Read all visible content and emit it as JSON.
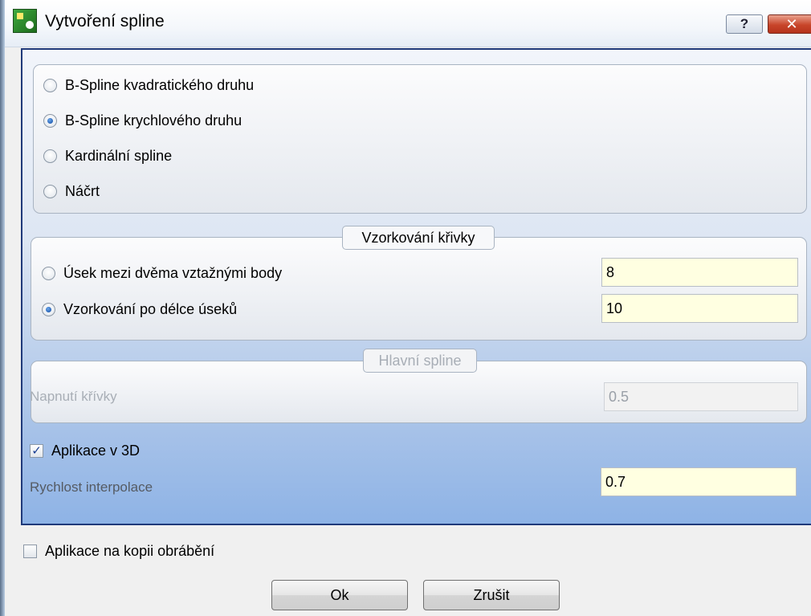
{
  "window": {
    "title": "Vytvoření spline",
    "help_label": "?",
    "close_label": "✕"
  },
  "spline_type": {
    "options": [
      {
        "label": "B-Spline kvadratického druhu",
        "checked": false
      },
      {
        "label": "B-Spline krychlového druhu",
        "checked": true
      },
      {
        "label": "Kardinální spline",
        "checked": false
      },
      {
        "label": "Náčrt",
        "checked": false
      }
    ]
  },
  "sampling": {
    "legend": "Vzorkování křivky",
    "options": [
      {
        "label": "Úsek mezi dvěma vztažnými body",
        "checked": false,
        "value": "8"
      },
      {
        "label": "Vzorkování po délce úseků",
        "checked": true,
        "value": "10"
      }
    ]
  },
  "main_spline": {
    "legend": "Hlavní spline",
    "tension_label": "Napnutí křívky",
    "tension_value": "0.5",
    "disabled": true
  },
  "apply_3d": {
    "label": "Aplikace v 3D",
    "checked": true,
    "speed_label": "Rychlost interpolace",
    "speed_value": "0.7"
  },
  "apply_copy": {
    "label": "Aplikace na kopii obrábění",
    "checked": false
  },
  "buttons": {
    "ok": "Ok",
    "cancel": "Zrušit"
  },
  "colors": {
    "panel_border": "#203a7a",
    "field_bg": "#ffffe1",
    "close_red": "#c8452a"
  }
}
